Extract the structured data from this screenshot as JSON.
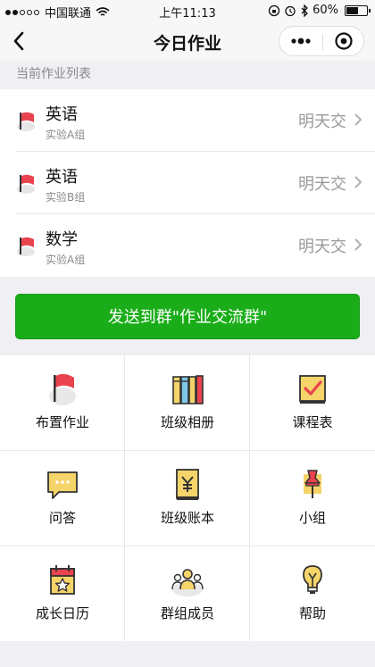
{
  "status": {
    "carrier": "中国联通",
    "time": "上午11:13",
    "battery": "60%",
    "battery_level": 0.6
  },
  "nav": {
    "title": "今日作业",
    "back_icon": "chevron-left-icon",
    "more_icon": "more-dots-icon",
    "close_icon": "target-circle-icon"
  },
  "section": {
    "header": "当前作业列表"
  },
  "homework": [
    {
      "subject": "英语",
      "group": "实验A组",
      "due": "明天交",
      "icon": "red-flag-icon"
    },
    {
      "subject": "英语",
      "group": "实验B组",
      "due": "明天交",
      "icon": "red-flag-icon"
    },
    {
      "subject": "数学",
      "group": "实验A组",
      "due": "明天交",
      "icon": "red-flag-icon"
    }
  ],
  "send_button": {
    "label": "发送到群\"作业交流群\""
  },
  "grid": [
    {
      "label": "布置作业",
      "icon": "flag-icon"
    },
    {
      "label": "班级相册",
      "icon": "books-icon"
    },
    {
      "label": "课程表",
      "icon": "checkbox-icon"
    },
    {
      "label": "问答",
      "icon": "chat-bubble-icon"
    },
    {
      "label": "班级账本",
      "icon": "yen-ledger-icon"
    },
    {
      "label": "小组",
      "icon": "pushpin-icon"
    },
    {
      "label": "成长日历",
      "icon": "calendar-star-icon"
    },
    {
      "label": "群组成员",
      "icon": "group-members-icon"
    },
    {
      "label": "帮助",
      "icon": "lightbulb-icon"
    }
  ],
  "colors": {
    "accent_green": "#1aad19",
    "flag_red": "#e8434e",
    "icon_yellow": "#f5d46a",
    "background": "#efeff4"
  }
}
